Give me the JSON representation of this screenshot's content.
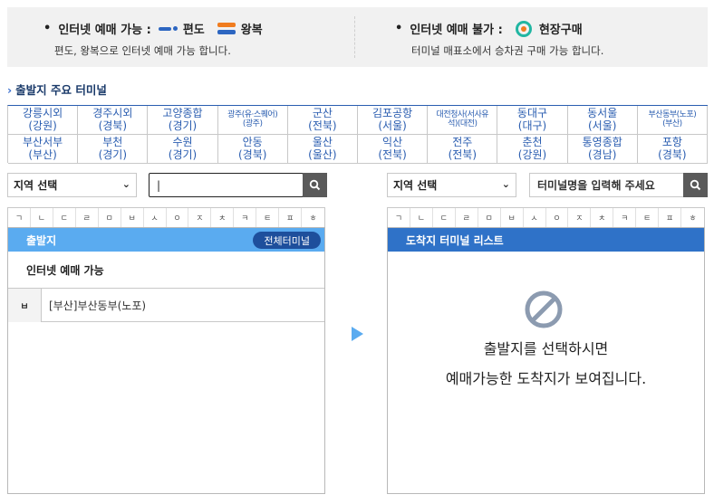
{
  "legend": {
    "online_title": "인터넷 예매 가능 :",
    "oneway_label": "편도",
    "round_label": "왕복",
    "online_sub": "편도, 왕복으로 인터넷 예매 가능 합니다.",
    "offline_title": "인터넷 예매 불가 :",
    "onsite_label": "현장구매",
    "offline_sub": "터미널 매표소에서 승차권 구매 가능 합니다.",
    "colors": {
      "oneway": "#2d66c1",
      "round_top": "#f07c1f",
      "round_bottom": "#2d66c1",
      "onsite_ring": "#21b6a2"
    }
  },
  "section_title": "출발지 주요 터미널",
  "terminals": [
    {
      "name": "강릉시외",
      "region": "(강원)"
    },
    {
      "name": "경주시외",
      "region": "(경북)"
    },
    {
      "name": "고양종합",
      "region": "(경기)"
    },
    {
      "name": "광주(유·스퀘어)",
      "region": "(광주)",
      "small": true
    },
    {
      "name": "군산",
      "region": "(전북)"
    },
    {
      "name": "김포공항",
      "region": "(서울)"
    },
    {
      "name": "대전청사(서사유",
      "region": "석)(대전)",
      "small": true
    },
    {
      "name": "동대구",
      "region": "(대구)"
    },
    {
      "name": "동서울",
      "region": "(서울)"
    },
    {
      "name": "부산동부(노포)",
      "region": "(부산)",
      "small": true
    },
    {
      "name": "부산서부",
      "region": "(부산)"
    },
    {
      "name": "부천",
      "region": "(경기)"
    },
    {
      "name": "수원",
      "region": "(경기)"
    },
    {
      "name": "안동",
      "region": "(경북)"
    },
    {
      "name": "울산",
      "region": "(울산)"
    },
    {
      "name": "익산",
      "region": "(전북)"
    },
    {
      "name": "전주",
      "region": "(전북)"
    },
    {
      "name": "춘천",
      "region": "(강원)"
    },
    {
      "name": "통영종합",
      "region": "(경남)"
    },
    {
      "name": "포항",
      "region": "(경북)"
    }
  ],
  "departure": {
    "region_select": "지역 선택",
    "search_value": "|",
    "index": [
      "ㄱ",
      "ㄴ",
      "ㄷ",
      "ㄹ",
      "ㅁ",
      "ㅂ",
      "ㅅ",
      "ㅇ",
      "ㅈ",
      "ㅊ",
      "ㅋ",
      "ㅌ",
      "ㅍ",
      "ㅎ"
    ],
    "header": "출발지",
    "all_button": "전체터미널",
    "available_title": "인터넷 예매 가능",
    "rows": [
      {
        "key": "ㅂ",
        "name": "[부산]부산동부(노포)"
      }
    ]
  },
  "arrival": {
    "region_select": "지역 선택",
    "search_placeholder": "터미널명을 입력해 주세요",
    "index": [
      "ㄱ",
      "ㄴ",
      "ㄷ",
      "ㄹ",
      "ㅁ",
      "ㅂ",
      "ㅅ",
      "ㅇ",
      "ㅈ",
      "ㅊ",
      "ㅋ",
      "ㅌ",
      "ㅍ",
      "ㅎ"
    ],
    "header": "도착지 터미널 리스트",
    "empty_line1": "출발지를 선택하시면",
    "empty_line2": "예매가능한 도착지가 보여집니다."
  }
}
